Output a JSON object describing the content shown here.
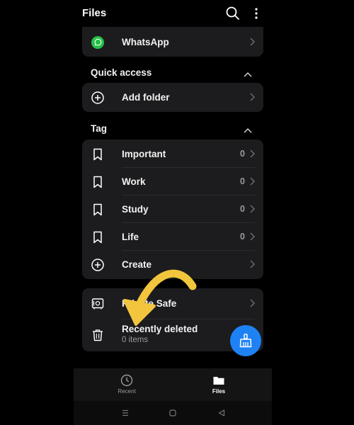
{
  "header": {
    "title": "Files"
  },
  "top_card": {
    "whatsapp_label": "WhatsApp"
  },
  "quick_access": {
    "title": "Quick access",
    "add_folder_label": "Add folder"
  },
  "tag": {
    "title": "Tag",
    "items": [
      {
        "label": "Important",
        "count": "0"
      },
      {
        "label": "Work",
        "count": "0"
      },
      {
        "label": "Study",
        "count": "0"
      },
      {
        "label": "Life",
        "count": "0"
      }
    ],
    "create_label": "Create"
  },
  "misc": {
    "private_safe_label": "Private Safe",
    "recently_deleted_label": "Recently deleted",
    "recently_deleted_sub": "0 items"
  },
  "bottom_nav": {
    "recent_label": "Recent",
    "files_label": "Files"
  },
  "colors": {
    "fab": "#1e82f5",
    "whatsapp": "#25c149",
    "arrow": "#f2c53d"
  }
}
